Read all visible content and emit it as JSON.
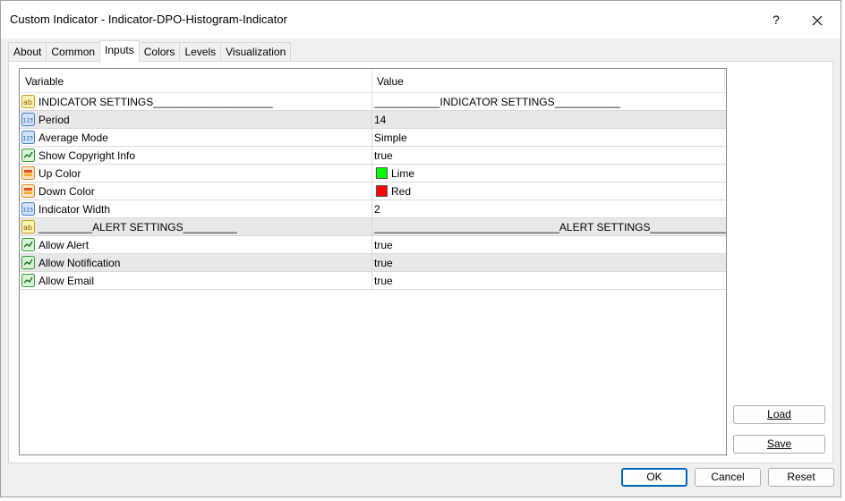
{
  "window": {
    "title": "Custom Indicator - Indicator-DPO-Histogram-Indicator",
    "help_label": "?",
    "close_label": "✕"
  },
  "tabs": [
    {
      "label": "About"
    },
    {
      "label": "Common"
    },
    {
      "label": "Inputs",
      "active": true
    },
    {
      "label": "Colors"
    },
    {
      "label": "Levels"
    },
    {
      "label": "Visualization"
    }
  ],
  "grid": {
    "headers": {
      "variable": "Variable",
      "value": "Value"
    },
    "rows": [
      {
        "icon": "string-icon",
        "name": "INDICATOR SETTINGS____________________",
        "value": "___________INDICATOR SETTINGS___________"
      },
      {
        "icon": "number-icon",
        "name": "Period",
        "value": "14"
      },
      {
        "icon": "number-icon",
        "name": "Average Mode",
        "value": "Simple"
      },
      {
        "icon": "bool-icon",
        "name": "Show Copyright Info",
        "value": "true"
      },
      {
        "icon": "color-icon",
        "name": "Up Color",
        "value": "Lime",
        "color": "#00ff00"
      },
      {
        "icon": "color-icon",
        "name": "Down Color",
        "value": "Red",
        "color": "#ff0000"
      },
      {
        "icon": "number-icon",
        "name": "Indicator Width",
        "value": "2"
      },
      {
        "icon": "string-icon",
        "name": "_________ALERT SETTINGS_________",
        "value": "_______________________________ALERT SETTINGS__________________..."
      },
      {
        "icon": "bool-icon",
        "name": "Allow Alert",
        "value": "true"
      },
      {
        "icon": "bool-icon",
        "name": "Allow Notification",
        "value": "true"
      },
      {
        "icon": "bool-icon",
        "name": "Allow Email",
        "value": "true"
      }
    ]
  },
  "side_buttons": {
    "load": "Load",
    "save": "Save"
  },
  "footer_buttons": {
    "ok": "OK",
    "cancel": "Cancel",
    "reset": "Reset"
  },
  "colors": {
    "accent": "#0067c0",
    "row_alt": "#e8e8e8"
  }
}
